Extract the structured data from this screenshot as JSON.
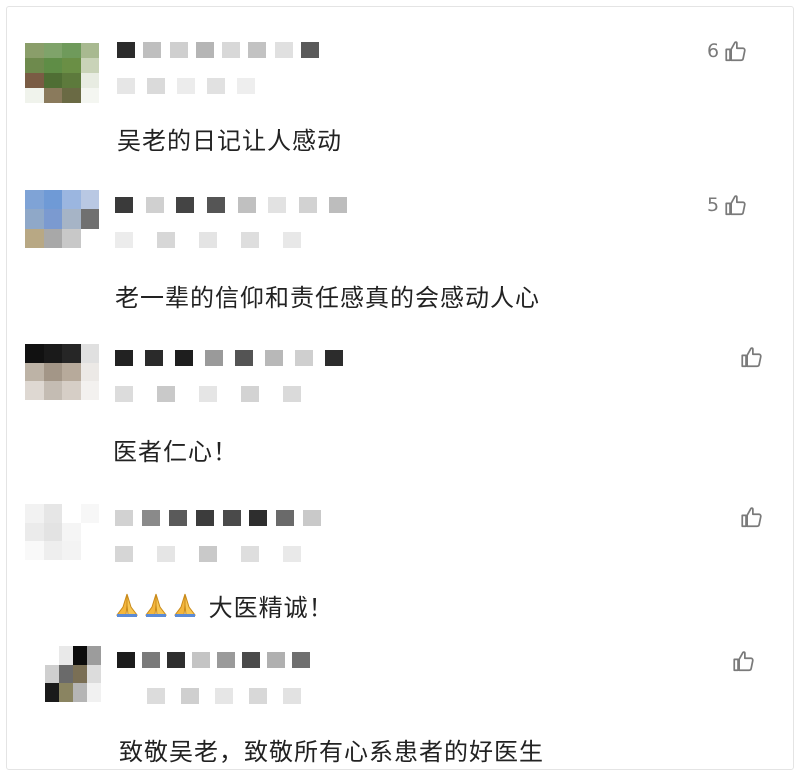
{
  "comments": [
    {
      "avatar_colors": [
        "#8a9e6a",
        "#7fa36a",
        "#6f9a5b",
        "#a8b990",
        "#6e8a4d",
        "#5f8d46",
        "#6a8f45",
        "#c9d3b8",
        "#7a5c44",
        "#4f6e34",
        "#5d7a3c",
        "#e8ece2",
        "#f0f3ec",
        "#8a7a5c",
        "#6a6a44",
        "#f4f6f1"
      ],
      "name_colors": [
        "#2b2b2b",
        "#bfbfbf",
        "#cfcfcf",
        "#b5b5b5",
        "#d8d8d8",
        "#c2c2c2",
        "#e0e0e0",
        "#5a5a5a"
      ],
      "meta_colors": [
        "#e6e6e6",
        "#dadada",
        "#ececec",
        "#e1e1e1",
        "#eeeeee"
      ],
      "text": "吴老的日记让人感动",
      "likes": "6"
    },
    {
      "avatar_colors": [
        "#7fa3d6",
        "#6f9ad6",
        "#9bb6e0",
        "#b9c8e3",
        "#8fa8c8",
        "#7b9ad0",
        "#a6b4c6",
        "#707070",
        "#b8a884",
        "#a8a8a8",
        "#c8c8c8",
        "#ffffff"
      ],
      "name_colors": [
        "#3a3a3a",
        "#d0d0d0",
        "#444444",
        "#555555",
        "#c0c0c0",
        "#e2e2e2",
        "#d2d2d2",
        "#bdbdbd"
      ],
      "meta_colors": [
        "#ececec",
        "#d7d7d7",
        "#e4e4e4",
        "#dedede",
        "#e8e8e8"
      ],
      "text": "老一辈的信仰和责任感真的会感动人心",
      "likes": "5"
    },
    {
      "avatar_colors": [
        "#111111",
        "#1a1a1a",
        "#262626",
        "#e0e0e0",
        "#bdb3a6",
        "#a39687",
        "#b7aa9b",
        "#ece9e6",
        "#ded8d2",
        "#c4bcb3",
        "#d6cec6",
        "#f3f1ef"
      ],
      "name_colors": [
        "#222222",
        "#2a2a2a",
        "#1e1e1e",
        "#9a9a9a",
        "#545454",
        "#b8b8b8",
        "#cfcfcf",
        "#2c2c2c"
      ],
      "meta_colors": [
        "#dcdcdc",
        "#c9c9c9",
        "#e5e5e5",
        "#d3d3d3",
        "#dadada"
      ],
      "text": "医者仁心！",
      "likes": ""
    },
    {
      "avatar_colors": [
        "#f2f2f2",
        "#e6e6e6",
        "#ffffff",
        "#f7f7f7",
        "#ebebeb",
        "#e3e3e3",
        "#f5f5f5",
        "#ffffff",
        "#f9f9f9",
        "#eeeeee",
        "#f3f3f3",
        "#ffffff"
      ],
      "name_colors": [
        "#d2d2d2",
        "#8a8a8a",
        "#5a5a5a",
        "#3c3c3c",
        "#4a4a4a",
        "#2e2e2e",
        "#6a6a6a",
        "#c9c9c9"
      ],
      "meta_colors": [
        "#d6d6d6",
        "#e5e5e5",
        "#c9c9c9",
        "#dedede",
        "#e9e9e9"
      ],
      "text": "大医精诚！",
      "emoji_count": 3,
      "likes": ""
    },
    {
      "avatar_colors": [
        "#ffffff",
        "#e9e9e9",
        "#0c0c0c",
        "#9c9c9c",
        "#cfcfcf",
        "#6a6a6a",
        "#7a6f55",
        "#dcdcdc",
        "#1a1a1a",
        "#8a8461",
        "#b5b5b5",
        "#f1f1f1"
      ],
      "name_colors": [
        "#1c1c1c",
        "#7a7a7a",
        "#2e2e2e",
        "#c4c4c4",
        "#9a9a9a",
        "#4a4a4a",
        "#b0b0b0",
        "#6f6f6f"
      ],
      "meta_colors": [
        "#dcdcdc",
        "#cfcfcf",
        "#e6e6e6",
        "#d8d8d8",
        "#e2e2e2"
      ],
      "text": "致敬吴老，致敬所有心系患者的好医生",
      "likes": ""
    }
  ]
}
